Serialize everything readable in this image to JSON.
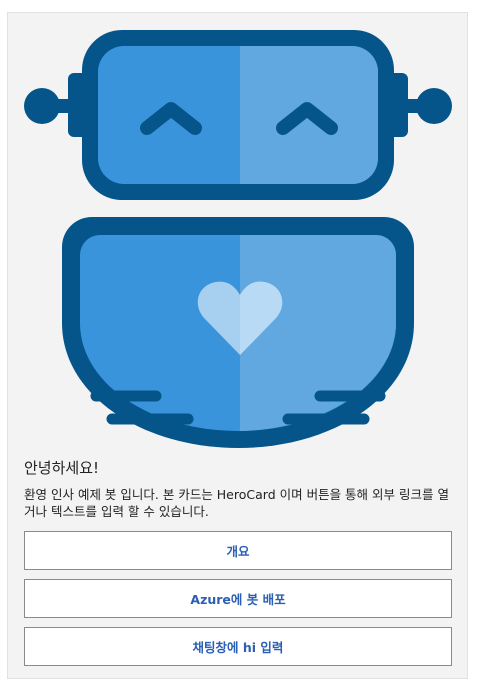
{
  "card": {
    "title": "안녕하세요!",
    "text": "환영 인사 예제 봇 입니다. 본 카드는 HeroCard 이며 버튼을 통해 외부 링크를 열거나 텍스트를 입력 할 수 있습니다.",
    "buttons": [
      {
        "label": "개요"
      },
      {
        "label": "Azure에 봇 배포"
      },
      {
        "label": "채팅창에 hi 입력"
      }
    ]
  },
  "colors": {
    "dark_blue": "#05558a",
    "mid_blue": "#3a94db",
    "light_blue": "#62a8e0",
    "heart": "#a6cff0",
    "button_text": "#2b5fb3"
  }
}
